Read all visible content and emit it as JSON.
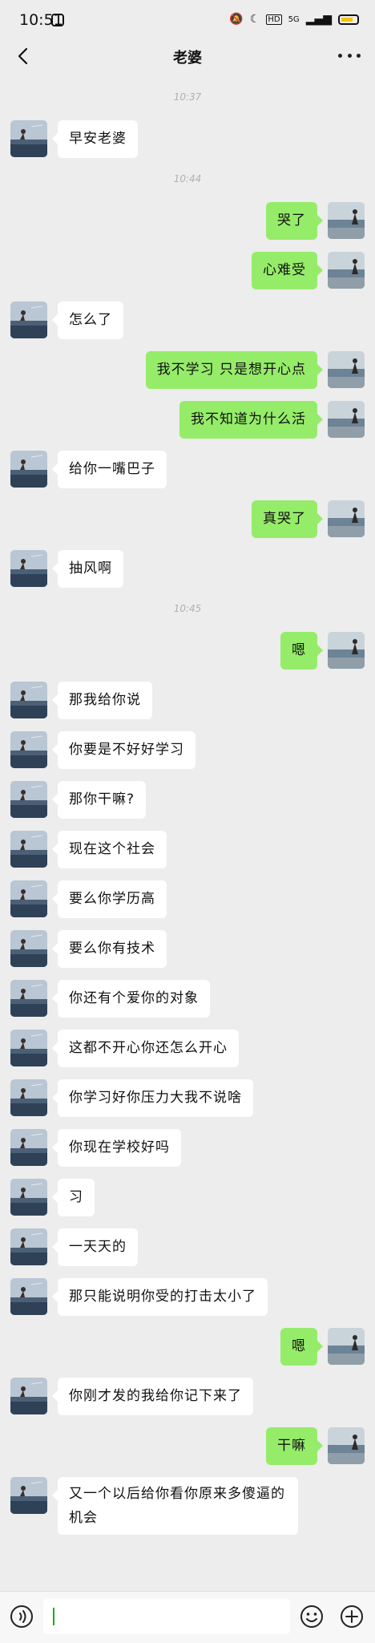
{
  "status_bar": {
    "time": "10:51",
    "network": "5G",
    "hd": "HD"
  },
  "header": {
    "title": "老婆"
  },
  "chat": [
    {
      "kind": "time",
      "text": "10:37"
    },
    {
      "kind": "msg",
      "side": "left",
      "text": "早安老婆"
    },
    {
      "kind": "time",
      "text": "10:44"
    },
    {
      "kind": "msg",
      "side": "right",
      "text": "哭了"
    },
    {
      "kind": "msg",
      "side": "right",
      "text": "心难受"
    },
    {
      "kind": "msg",
      "side": "left",
      "text": "怎么了"
    },
    {
      "kind": "msg",
      "side": "right",
      "text": "我不学习 只是想开心点"
    },
    {
      "kind": "msg",
      "side": "right",
      "text": "我不知道为什么活"
    },
    {
      "kind": "msg",
      "side": "left",
      "text": "给你一嘴巴子"
    },
    {
      "kind": "msg",
      "side": "right",
      "text": "真哭了"
    },
    {
      "kind": "msg",
      "side": "left",
      "text": "抽风啊"
    },
    {
      "kind": "time",
      "text": "10:45"
    },
    {
      "kind": "msg",
      "side": "right",
      "text": "嗯"
    },
    {
      "kind": "msg",
      "side": "left",
      "text": "那我给你说"
    },
    {
      "kind": "msg",
      "side": "left",
      "text": "你要是不好好学习"
    },
    {
      "kind": "msg",
      "side": "left",
      "text": "那你干嘛?"
    },
    {
      "kind": "msg",
      "side": "left",
      "text": "现在这个社会"
    },
    {
      "kind": "msg",
      "side": "left",
      "text": "要么你学历高"
    },
    {
      "kind": "msg",
      "side": "left",
      "text": "要么你有技术"
    },
    {
      "kind": "msg",
      "side": "left",
      "text": "你还有个爱你的对象"
    },
    {
      "kind": "msg",
      "side": "left",
      "text": "这都不开心你还怎么开心"
    },
    {
      "kind": "msg",
      "side": "left",
      "text": "你学习好你压力大我不说啥"
    },
    {
      "kind": "msg",
      "side": "left",
      "text": "你现在学校好吗"
    },
    {
      "kind": "msg",
      "side": "left",
      "text": "习"
    },
    {
      "kind": "msg",
      "side": "left",
      "text": "一天天的"
    },
    {
      "kind": "msg",
      "side": "left",
      "text": "那只能说明你受的打击太小了"
    },
    {
      "kind": "msg",
      "side": "right",
      "text": "嗯"
    },
    {
      "kind": "msg",
      "side": "left",
      "text": "你刚才发的我给你记下来了"
    },
    {
      "kind": "msg",
      "side": "right",
      "text": "干嘛"
    },
    {
      "kind": "msg",
      "side": "left",
      "text": "又一个以后给你看你原来多傻逼的机会",
      "multi": true
    }
  ],
  "input": {
    "value": ""
  },
  "icons": {
    "back": "chevron-left-icon",
    "more": "more-icon",
    "voice": "voice-icon",
    "emoji": "emoji-icon",
    "plus": "plus-icon"
  },
  "colors": {
    "background": "#ededed",
    "bubble_self": "#95ec69",
    "bubble_other": "#ffffff",
    "timestamp": "#b0b0b0"
  }
}
